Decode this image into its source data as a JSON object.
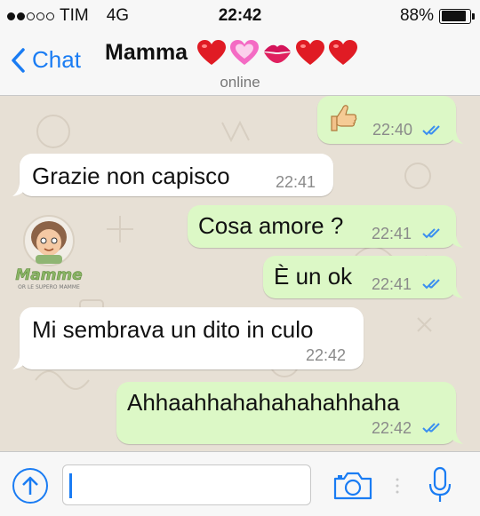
{
  "status_bar": {
    "carrier": "TIM",
    "network": "4G",
    "time": "22:42",
    "battery": "88%",
    "battery_level": 0.88,
    "signal_bars_filled": 2,
    "signal_bars_total": 5
  },
  "nav": {
    "back_label": "Chat",
    "contact_name": "Mamma",
    "emojis": [
      "red-heart-icon",
      "pink-heart-icon",
      "kiss-mark-icon",
      "red-heart-icon",
      "red-heart-icon"
    ],
    "presence": "online"
  },
  "messages": [
    {
      "direction": "out",
      "text": "",
      "emoji": "thumbs-up-icon",
      "time": "22:40",
      "read": true
    },
    {
      "direction": "in",
      "text": "Grazie non capisco",
      "time": "22:41"
    },
    {
      "direction": "out",
      "text": "Cosa amore ?",
      "time": "22:41",
      "read": true
    },
    {
      "direction": "out",
      "text": "È un ok",
      "time": "22:41",
      "read": true
    },
    {
      "direction": "in",
      "text": "Mi sembrava un dito in culo",
      "time": "22:42"
    },
    {
      "direction": "out",
      "text": "Ahhaahhahahahahahhaha",
      "time": "22:42",
      "read": true
    }
  ],
  "watermark": {
    "text": "Mamme",
    "subtext": "OR LE SUPERO MAMME"
  },
  "input": {
    "value": "",
    "placeholder": ""
  },
  "colors": {
    "accent": "#1a7cf3",
    "outgoing_bubble": "#dcf8c6",
    "incoming_bubble": "#ffffff",
    "chat_background": "#e7e0d5",
    "read_ticks": "#3b8ff0"
  }
}
